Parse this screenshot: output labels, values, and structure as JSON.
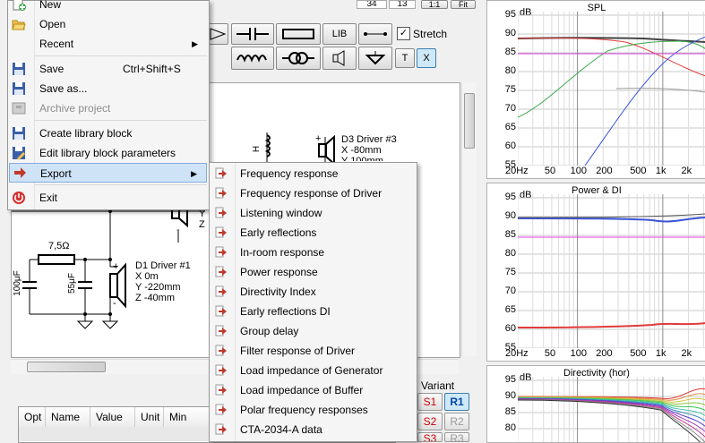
{
  "toolbar": {
    "coord_a": "34",
    "coord_b": "13",
    "zoom_11": "1:1",
    "fit": "Fit",
    "lib": "LIB",
    "stretch_label": "Stretch",
    "stretch_checked": true,
    "t_label": "T",
    "x_label": "X"
  },
  "schematic": {
    "d3": {
      "name": "D3 Driver #3",
      "x": "X -80mm",
      "y": "Y 100mm"
    },
    "d1": {
      "name": "D1 Driver #1",
      "x": "X 0m",
      "y": "Y -220mm",
      "z": "Z -40mm"
    },
    "r1": "7,5Ω",
    "c1": "100μF",
    "c2": "55μF",
    "l1": "H",
    "d2_y": "Y",
    "d2_z": "Z",
    "plus": "+",
    "minus": "-"
  },
  "param_grid": {
    "columns": [
      "Opt",
      "Name",
      "Value",
      "Unit",
      "Min"
    ]
  },
  "variant": {
    "label": "Variant",
    "buttons": [
      [
        "S1",
        "R1"
      ],
      [
        "S2",
        "R2"
      ],
      [
        "S3",
        "R3"
      ]
    ]
  },
  "graphs": {
    "spl": {
      "title": "SPL",
      "unit": "dB",
      "y_ticks": [
        "95",
        "90",
        "85",
        "80",
        "75",
        "70",
        "65",
        "60",
        "55"
      ],
      "x_ticks": [
        "20Hz",
        "50",
        "100",
        "200",
        "500",
        "1k",
        "2k"
      ]
    },
    "power": {
      "title": "Power & DI",
      "unit": "dB",
      "y_ticks": [
        "95",
        "90",
        "85",
        "80",
        "75",
        "70",
        "65",
        "60",
        "55"
      ],
      "x_ticks": [
        "20Hz",
        "50",
        "100",
        "200",
        "500",
        "1k",
        "2k"
      ]
    },
    "dir": {
      "title": "Directivity (hor)",
      "unit": "dB",
      "y_ticks": [
        "95",
        "90",
        "85",
        "80"
      ]
    }
  },
  "menu": {
    "items": [
      {
        "label": "New",
        "icon": "new-icon"
      },
      {
        "label": "Open",
        "icon": "open-folder-icon"
      },
      {
        "label": "Recent",
        "icon": "",
        "submenu": true
      },
      {
        "label": "Save",
        "shortcut": "Ctrl+Shift+S",
        "icon": "save-icon"
      },
      {
        "label": "Save as...",
        "icon": "save-as-icon"
      },
      {
        "label": "Archive project",
        "icon": "archive-icon",
        "disabled": true
      },
      {
        "label": "Create library block",
        "icon": "library-save-icon"
      },
      {
        "label": "Edit library block parameters",
        "icon": "library-edit-icon"
      },
      {
        "label": "Export",
        "icon": "export-icon",
        "submenu": true,
        "highlighted": true
      },
      {
        "label": "Exit",
        "icon": "exit-icon"
      }
    ]
  },
  "export_submenu": {
    "items": [
      "Frequency response",
      "Frequency response of Driver",
      "Listening window",
      "Early reflections",
      "In-room response",
      "Power response",
      "Directivity Index",
      "Early reflections DI",
      "Group delay",
      "Filter response of Driver",
      "Load impedance of Generator",
      "Load impedance of Buffer",
      "Polar frequency responses",
      "CTA-2034-A data"
    ]
  },
  "colors": {
    "menu_highlight": "#cfe3f7",
    "export_arrow": "#c0392b",
    "magenta": "#e040e0"
  }
}
